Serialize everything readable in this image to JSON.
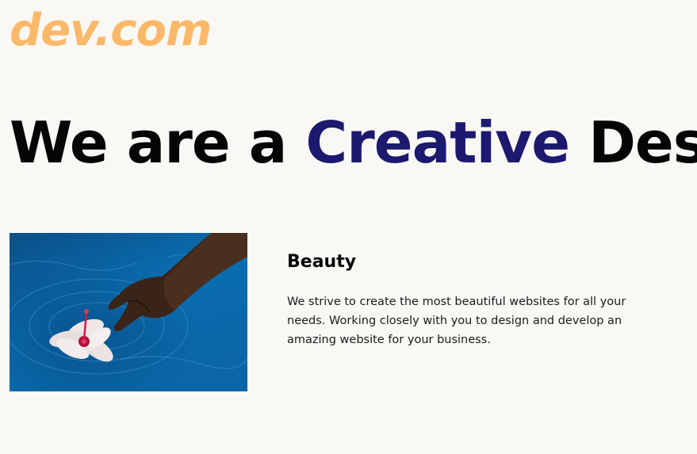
{
  "header": {
    "logo_text": "dev.com"
  },
  "hero": {
    "prefix": "We are a ",
    "accent": "Creative",
    "suffix": " Design"
  },
  "feature": {
    "image_alt": "hand touching a flower floating on blue water",
    "title": "Beauty",
    "description": "We strive to create the most beautiful websites for all your needs. Working closely with you to design and develop an amazing website for your business."
  },
  "colors": {
    "background": "#faf8f5",
    "logo": "#fcb869",
    "accent": "#1c1a6e",
    "text": "#050505"
  }
}
